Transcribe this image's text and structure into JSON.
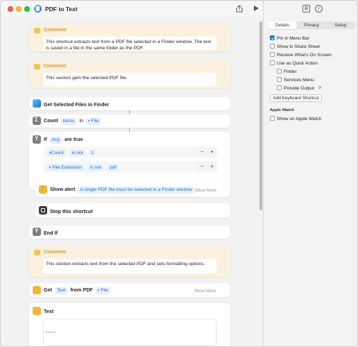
{
  "window": {
    "title": "PDF to Text"
  },
  "toolbar": {
    "share_icon": "share-icon",
    "run_icon": "play-icon"
  },
  "colors": {
    "accent": "#1a6fd8",
    "comment_bg": "#fbf1de",
    "comment_label": "#d29a3a",
    "token_bg": "#e6f0fc"
  },
  "blocks": {
    "comment1": {
      "label": "Comment",
      "text": "This shortcut extracts text from a PDF file selected in a Finder window. The text is saved in a file in the same folder as the PDF."
    },
    "comment2": {
      "label": "Comment",
      "text": "This section gets the selected PDF file."
    },
    "get_files": {
      "title": "Get Selected Files in Finder"
    },
    "count": {
      "label": "Count",
      "token1": "Items",
      "in": "in",
      "token2": "File"
    },
    "if": {
      "label": "If",
      "token": "Any",
      "suffix": "are true"
    },
    "cond1": {
      "var": "Count",
      "op": "is not",
      "val": "1",
      "minus": "−",
      "plus": "+"
    },
    "cond2": {
      "var": "File Extension",
      "op": "is not",
      "val": "pdf",
      "minus": "−",
      "plus": "+"
    },
    "alert": {
      "label": "Show alert",
      "token": "A single PDF file must be selected in a Finder window",
      "more": "Show More"
    },
    "stop": {
      "title": "Stop this shortcut"
    },
    "endif": {
      "title": "End If"
    },
    "comment3": {
      "label": "Comment",
      "text": "This section extracts text from the selected PDF and sets formatting options."
    },
    "get_text": {
      "label": "Get",
      "token1": "Text",
      "from": "from PDF",
      "token2": "File",
      "more": "Show More"
    },
    "text": {
      "label": "Text",
      "content": "-----"
    }
  },
  "sidebar": {
    "tabs": [
      "Details",
      "Privacy",
      "Setup"
    ],
    "selected_tab": "Details",
    "options": [
      {
        "label": "Pin in Menu Bar",
        "checked": true
      },
      {
        "label": "Show in Share Sheet",
        "checked": false
      },
      {
        "label": "Receive What's On Screen",
        "checked": false
      },
      {
        "label": "Use as Quick Action",
        "checked": false
      },
      {
        "label": "Finder",
        "checked": false
      },
      {
        "label": "Services Menu",
        "checked": false
      },
      {
        "label": "Provide Output",
        "checked": false
      }
    ],
    "help": "?",
    "keyboard_button": "Add Keyboard Shortcut",
    "apple_watch_section": "Apple Watch",
    "apple_watch_option": {
      "label": "Show on Apple Watch",
      "checked": false
    }
  }
}
